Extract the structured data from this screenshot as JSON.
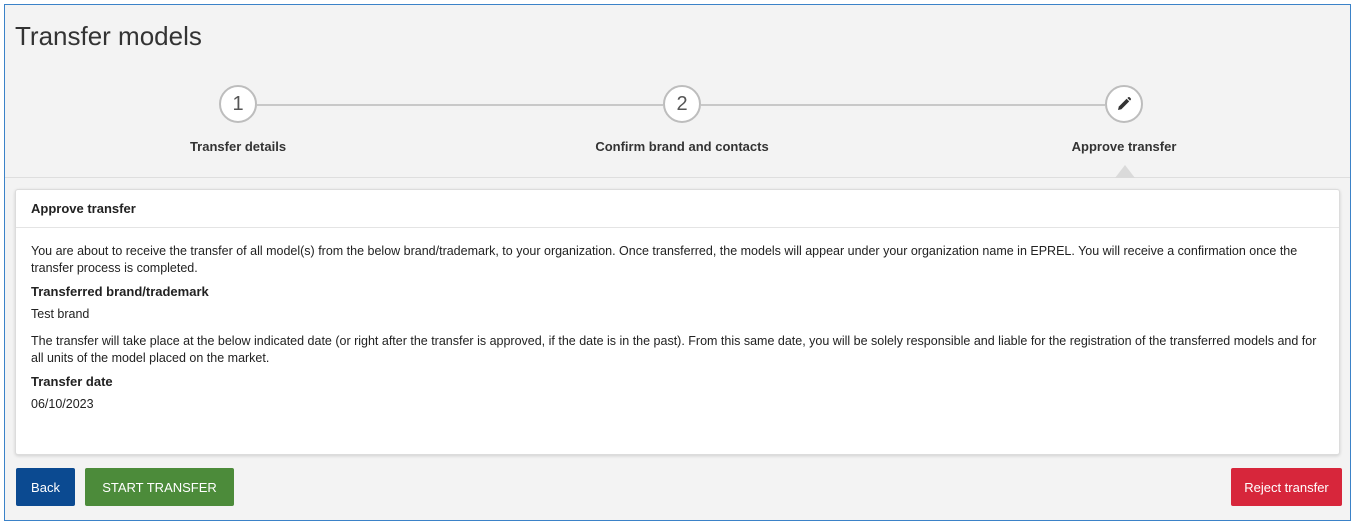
{
  "page": {
    "title": "Transfer models"
  },
  "stepper": {
    "steps": [
      {
        "number": "1",
        "label": "Transfer details"
      },
      {
        "number": "2",
        "label": "Confirm brand and contacts"
      },
      {
        "icon": "pencil-icon",
        "label": "Approve transfer"
      }
    ],
    "active_index": 2
  },
  "panel": {
    "title": "Approve transfer",
    "intro": "You are about to receive the transfer of all model(s) from the below brand/trademark, to your organization. Once transferred, the models will appear under your organization name in EPREL. You will receive a confirmation once the transfer process is completed.",
    "brand_label": "Transferred brand/trademark",
    "brand_value": "Test brand",
    "date_note": "The transfer will take place at the below indicated date (or right after the transfer is approved, if the date is in the past). From this same date, you will be solely responsible and liable for the registration of the transferred models and for all units of the model placed on the market.",
    "date_label": "Transfer date",
    "date_value": "06/10/2023"
  },
  "actions": {
    "back_label": "Back",
    "start_label": "START TRANSFER",
    "reject_label": "Reject transfer"
  },
  "colors": {
    "primary": "#0b4a91",
    "success": "#4c8b3a",
    "danger": "#d7263b",
    "frame_border": "#3b82c8"
  }
}
